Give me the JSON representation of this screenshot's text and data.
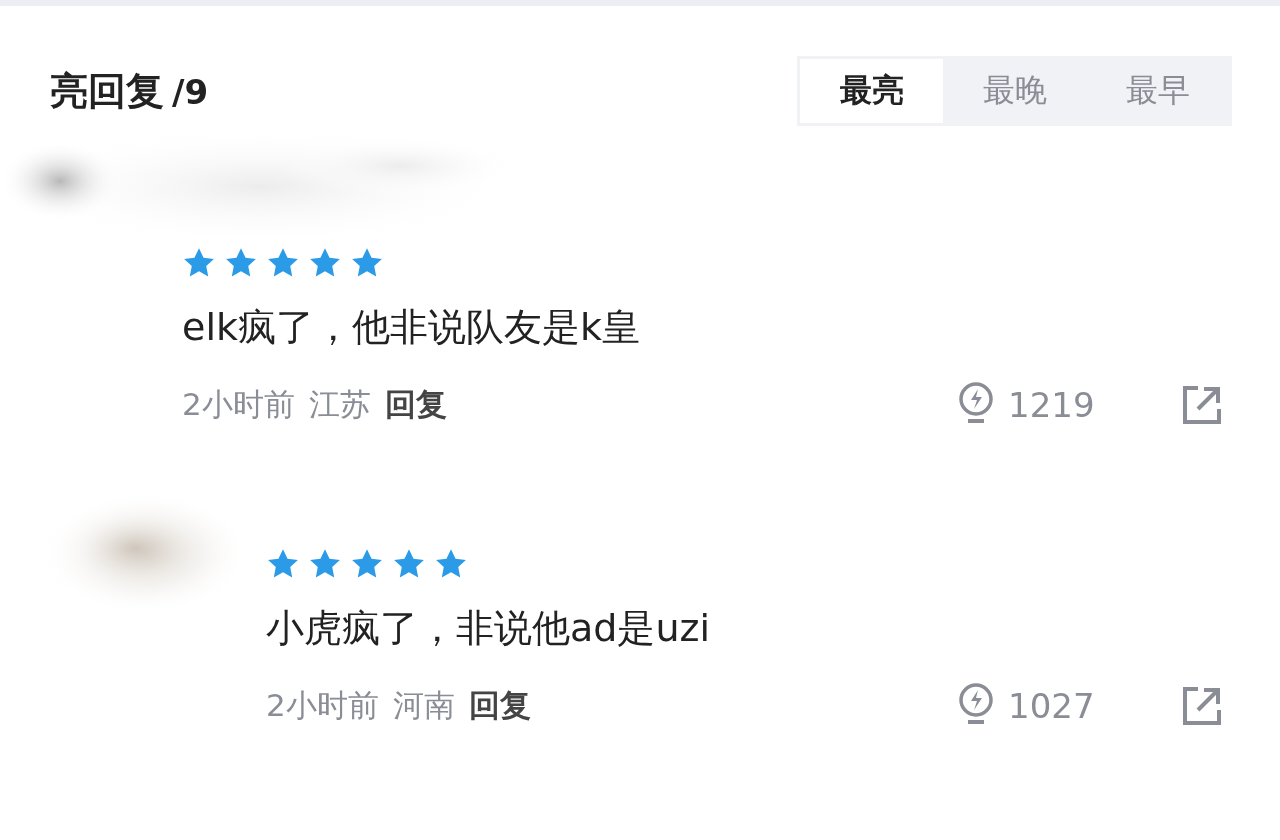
{
  "header": {
    "title": "亮回复",
    "count": "/9"
  },
  "sort_tabs": [
    {
      "label": "最亮",
      "selected": true
    },
    {
      "label": "最晚",
      "selected": false
    },
    {
      "label": "最早",
      "selected": false
    }
  ],
  "comments": [
    {
      "stars": 5,
      "text": "elk疯了，他非说队友是k皇",
      "time": "2小时前",
      "location": "江苏",
      "reply": "回复",
      "likes": "1219",
      "children": [
        {
          "stars": 5,
          "text": "小虎疯了，非说他ad是uzi",
          "time": "2小时前",
          "location": "河南",
          "reply": "回复",
          "likes": "1027"
        }
      ]
    }
  ]
}
